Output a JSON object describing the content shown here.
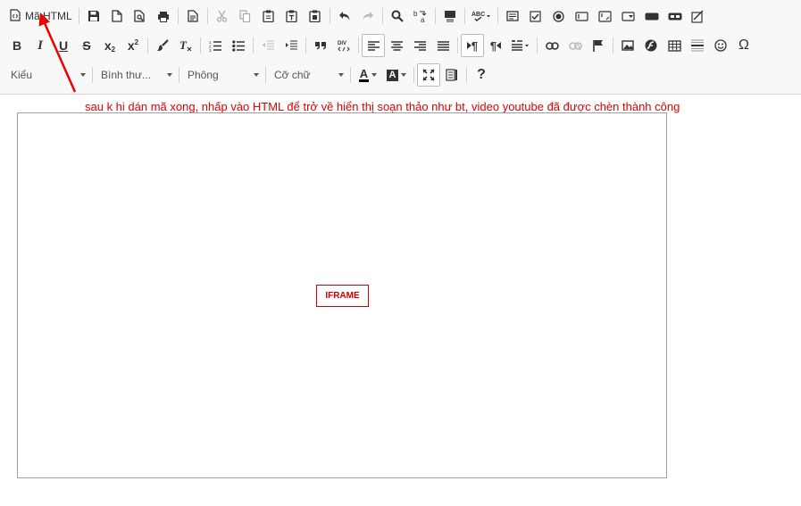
{
  "toolbar": {
    "source_label": "Mã HTML",
    "bold": "B",
    "italic": "I",
    "underline": "U",
    "strike": "S",
    "subscript": "x",
    "subscript_sub": "2",
    "superscript": "x",
    "superscript_sup": "2",
    "help": "?",
    "special_char": "Ω",
    "ltr_mark": "¶",
    "rtl_mark": "¶",
    "styles_label": "Kiểu",
    "format_label": "Bình thư...",
    "font_label": "Phông",
    "size_label": "Cỡ chữ",
    "text_color_glyph": "A",
    "bg_color_glyph": "A"
  },
  "editor": {
    "iframe_placeholder": "IFRAME"
  },
  "annotation": {
    "text": "sau k hi dán mã xong, nhấp vào HTML để trở về hiển thị soạn thảo như bt, video youtube đã được chèn thành công",
    "color": "#e00000"
  },
  "colors": {
    "toolbar_bg": "#f8f8f8",
    "icon": "#333333",
    "iframe_border": "#cc0000"
  }
}
